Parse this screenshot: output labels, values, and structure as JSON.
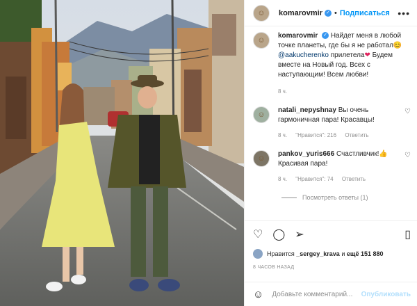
{
  "post": {
    "username": "komarovmir",
    "verified_glyph": "✓",
    "dot": "•",
    "follow_label": "Подписаться",
    "more_glyph": "•••"
  },
  "caption": {
    "user": "komarovmir",
    "text_a": "Найдет меня в любой точке планеты, где бы я не работал",
    "emoji_a": "😊",
    "mention": "@aakucherenko",
    "text_b": "прилетела",
    "emoji_b": "❤",
    "text_c": "Будем вместе на Новый год. Всех с наступающим! Всем любви!",
    "time": "8 ч."
  },
  "comments": [
    {
      "user": "natali_nepyshnay",
      "text": "Вы очень гармоничная пара! Красавцы!",
      "time": "8 ч.",
      "likes": "\"Нравится\": 216",
      "reply": "Ответить"
    },
    {
      "user": "pankov_yuris666",
      "text": "Счастливчик!👍 Красивая пара!",
      "time": "8 ч.",
      "likes": "\"Нравится\": 74",
      "reply": "Ответить"
    }
  ],
  "view_replies": "Посмотреть ответы (1)",
  "likes_line": {
    "prefix": "Нравится",
    "user": "_sergey_krava",
    "middle": "и",
    "count": "ещё 151 880"
  },
  "timestamp": "8 ЧАСОВ НАЗАД",
  "add_comment": {
    "placeholder": "Добавьте комментарий...",
    "publish": "Опубликовать"
  },
  "icons": [
    "heart-icon",
    "comment-icon",
    "share-icon",
    "save-icon",
    "emoji-icon",
    "more-icon"
  ]
}
